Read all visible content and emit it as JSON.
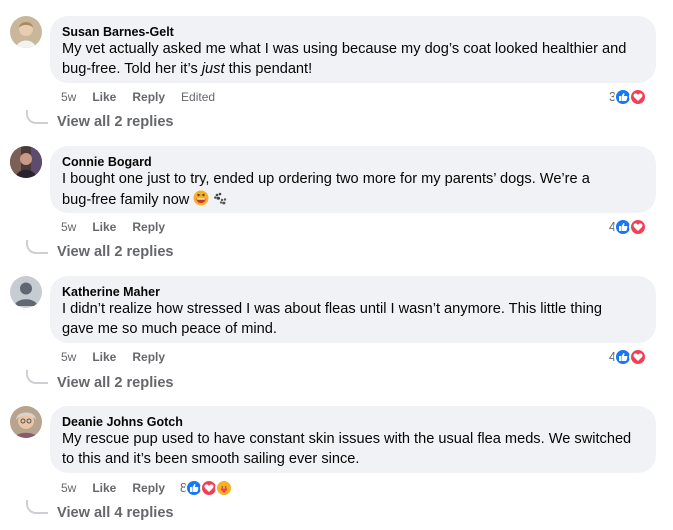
{
  "comments": [
    {
      "author": "Susan Barnes-Gelt",
      "text_line1": "My vet actually asked me what I was using because my dog’s coat looked healthier and",
      "text_line2a": "bug-free. Told her it’s ",
      "text_line2_em": "just",
      "text_line2b": " this pendant!",
      "time": "5w",
      "like": "Like",
      "reply": "Reply",
      "edited": "Edited",
      "reaction_count": "3",
      "view_replies": "View all 2 replies"
    },
    {
      "author": "Connie Bogard",
      "text_line1": "I bought one just to try, ended up ordering two more for my parents’ dogs. We’re a",
      "text_line2": "bug-free family now",
      "time": "5w",
      "like": "Like",
      "reply": "Reply",
      "reaction_count": "4",
      "view_replies": "View all 2 replies"
    },
    {
      "author": "Katherine Maher",
      "text_line1": "I didn’t realize how stressed I was about fleas until I wasn’t anymore. This little thing",
      "text_line2": "gave me so much peace of mind.",
      "time": "5w",
      "like": "Like",
      "reply": "Reply",
      "reaction_count": "4",
      "view_replies": "View all 2 replies"
    },
    {
      "author": "Deanie Johns Gotch",
      "text_line1": "My rescue pup used to have constant skin issues with the usual flea meds. We switched",
      "text_line2": "to this and it’s been smooth sailing ever since.",
      "time": "5w",
      "like": "Like",
      "reply": "Reply",
      "reaction_count": "8",
      "view_replies": "View all 4 replies"
    }
  ],
  "colors": {
    "bubble": "#f0f2f5",
    "meta": "#65676b",
    "like": "#1877f2",
    "love": "#f33e58",
    "care": "#f7b125"
  }
}
